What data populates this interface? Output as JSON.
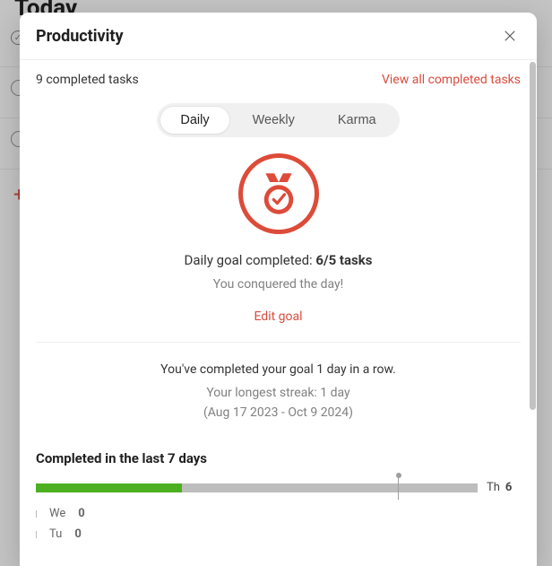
{
  "background": {
    "title": "Today"
  },
  "modal": {
    "title": "Productivity"
  },
  "summary": {
    "completed_text": "9 completed tasks",
    "view_all": "View all completed tasks"
  },
  "tabs": {
    "daily": "Daily",
    "weekly": "Weekly",
    "karma": "Karma",
    "active": "daily"
  },
  "goal": {
    "prefix": "Daily goal completed: ",
    "ratio": "6/5 tasks",
    "subline": "You conquered the day!",
    "edit": "Edit goal"
  },
  "streak": {
    "line": "You've completed your goal 1 day in a row.",
    "sub": "Your longest streak: 1 day",
    "range": "(Aug 17 2023 - Oct 9 2024)"
  },
  "chart": {
    "title": "Completed in the last 7 days",
    "today_label": "Th",
    "today_value": "6"
  },
  "history": {
    "rows": [
      {
        "label": "We",
        "value": "0"
      },
      {
        "label": "Tu",
        "value": "0"
      }
    ]
  },
  "chart_data": {
    "type": "bar",
    "categories": [
      "Th",
      "We",
      "Tu"
    ],
    "values": [
      6,
      0,
      0
    ],
    "goal": 5,
    "title": "Completed in the last 7 days",
    "xlabel": "",
    "ylabel": "",
    "ylim": [
      0,
      17
    ]
  },
  "colors": {
    "accent": "#db4c3f",
    "bar_fill": "#4caf1f",
    "bar_track": "#bdbdbd"
  }
}
